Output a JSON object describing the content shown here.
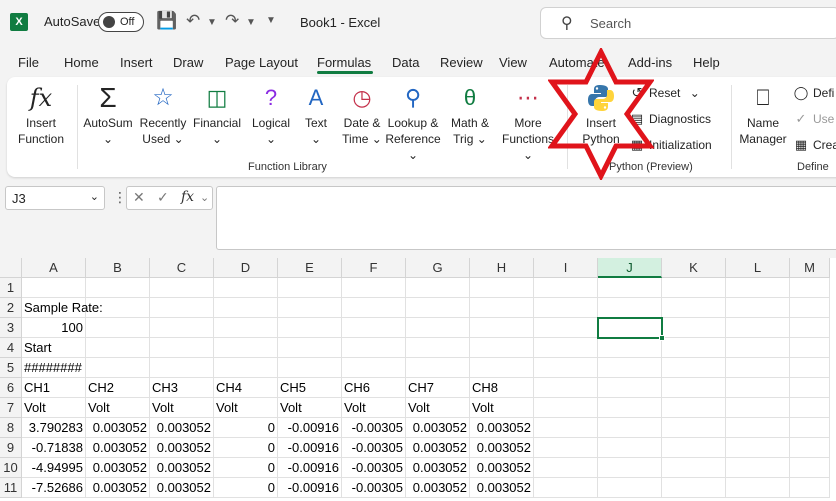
{
  "titlebar": {
    "logo_text": "X",
    "autosave_label": "AutoSave",
    "autosave_state": "Off",
    "doc_title": "Book1  -  Excel",
    "search_placeholder": "Search"
  },
  "tabs": [
    "File",
    "Home",
    "Insert",
    "Draw",
    "Page Layout",
    "Formulas",
    "Data",
    "Review",
    "View",
    "Automate",
    "Add-ins",
    "Help"
  ],
  "active_tab": "Formulas",
  "ribbon": {
    "insert_function": [
      "Insert",
      "Function"
    ],
    "autosum": "AutoSum",
    "recently_used": [
      "Recently",
      "Used"
    ],
    "financial": "Financial",
    "logical": "Logical",
    "text": "Text",
    "date_time": [
      "Date &",
      "Time"
    ],
    "lookup_reference": [
      "Lookup &",
      "Reference"
    ],
    "math_trig": [
      "Math &",
      "Trig"
    ],
    "more_functions": [
      "More",
      "Functions"
    ],
    "function_library_label": "Function Library",
    "insert_python": [
      "Insert",
      "Python"
    ],
    "reset": "Reset",
    "diagnostics": "Diagnostics",
    "initialization": "Initialization",
    "python_group_label": "Python (Preview)",
    "name_manager": [
      "Name",
      "Manager"
    ],
    "define_name": "Defi",
    "use_in_formula": "Use",
    "create_from_selection": "Crea",
    "defined_names_label": "Define"
  },
  "formula_bar": {
    "name_box": "J3",
    "cancel_icon": "x",
    "enter_icon": "check",
    "fx": "fx",
    "content": ""
  },
  "grid": {
    "columns": [
      "A",
      "B",
      "C",
      "D",
      "E",
      "F",
      "G",
      "H",
      "I",
      "J",
      "K",
      "L",
      "M"
    ],
    "selected_column": "J",
    "rows": [
      "1",
      "2",
      "3",
      "4",
      "5",
      "6",
      "7",
      "8",
      "9",
      "10",
      "11"
    ],
    "cells": {
      "A2": "Sample Rate:",
      "A3": "100",
      "A4": "Start",
      "A5": "########",
      "A6": "CH1",
      "B6": "CH2",
      "C6": "CH3",
      "D6": "CH4",
      "E6": "CH5",
      "F6": "CH6",
      "G6": "CH7",
      "H6": "CH8",
      "A7": "Volt",
      "B7": "Volt",
      "C7": "Volt",
      "D7": "Volt",
      "E7": "Volt",
      "F7": "Volt",
      "G7": "Volt",
      "H7": "Volt",
      "A8": "3.790283",
      "B8": "0.003052",
      "C8": "0.003052",
      "D8": "0",
      "E8": "-0.00916",
      "F8": "-0.00305",
      "G8": "0.003052",
      "H8": "0.003052",
      "A9": "-0.71838",
      "B9": "0.003052",
      "C9": "0.003052",
      "D9": "0",
      "E9": "-0.00916",
      "F9": "-0.00305",
      "G9": "0.003052",
      "H9": "0.003052",
      "A10": "-4.94995",
      "B10": "0.003052",
      "C10": "0.003052",
      "D10": "0",
      "E10": "-0.00916",
      "F10": "-0.00305",
      "G10": "0.003052",
      "H10": "0.003052",
      "A11": "-7.52686",
      "B11": "0.003052",
      "C11": "0.003052",
      "D11": "0",
      "E11": "-0.00916",
      "F11": "-0.00305",
      "G11": "0.003052",
      "H11": "0.003052"
    }
  },
  "colors": {
    "excel_green": "#107c41",
    "annotation_red": "#e0141b",
    "python_blue": "#3776ab",
    "python_yellow": "#ffd43b"
  }
}
